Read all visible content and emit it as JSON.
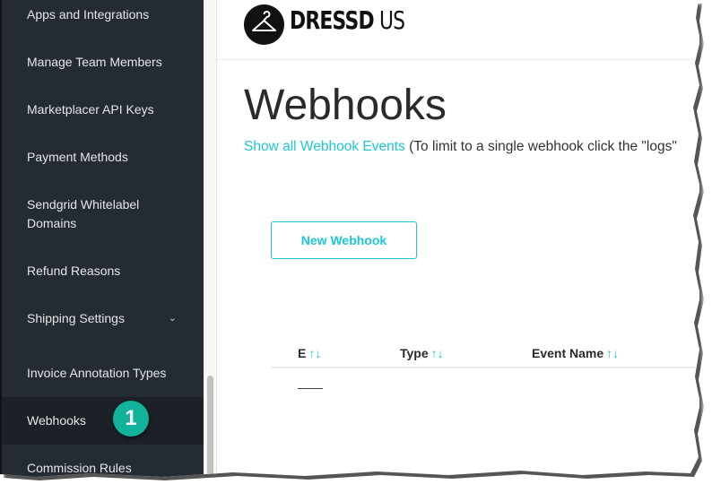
{
  "sidebar": {
    "items": [
      {
        "label": "Apps and Integrations"
      },
      {
        "label": "Manage Team Members"
      },
      {
        "label": "Marketplacer API Keys"
      },
      {
        "label": "Payment Methods"
      },
      {
        "label": "Sendgrid Whitelabel"
      },
      {
        "label": "Domains"
      },
      {
        "label": "Refund Reasons"
      },
      {
        "label": "Shipping Settings",
        "chevron": "chevron-down-icon"
      },
      {
        "label": "Invoice Annotation Types"
      },
      {
        "label": "Webhooks",
        "active": true
      },
      {
        "label": "Commission Rules"
      }
    ],
    "chevron_glyph": "⌄",
    "callout_badge": "1"
  },
  "header": {
    "logo_bold": "DRESSD",
    "logo_thin": " US",
    "logo_icon": "hanger-icon"
  },
  "main": {
    "title": "Webhooks",
    "events_link": "Show all Webhook Events",
    "events_note": " (To limit to a single webhook click the \"logs\"",
    "new_button": "New Webhook",
    "table": {
      "columns": [
        {
          "label": "E",
          "sort": "↑↓"
        },
        {
          "label": "Type",
          "sort": "↑↓"
        },
        {
          "label": "Event Name",
          "sort": "↑↓"
        }
      ],
      "rows": [
        {
          "cell": "——"
        }
      ]
    }
  },
  "colors": {
    "accent": "#1ec6d4",
    "sidebar_bg": "#252b33",
    "badge": "#12b39a"
  }
}
